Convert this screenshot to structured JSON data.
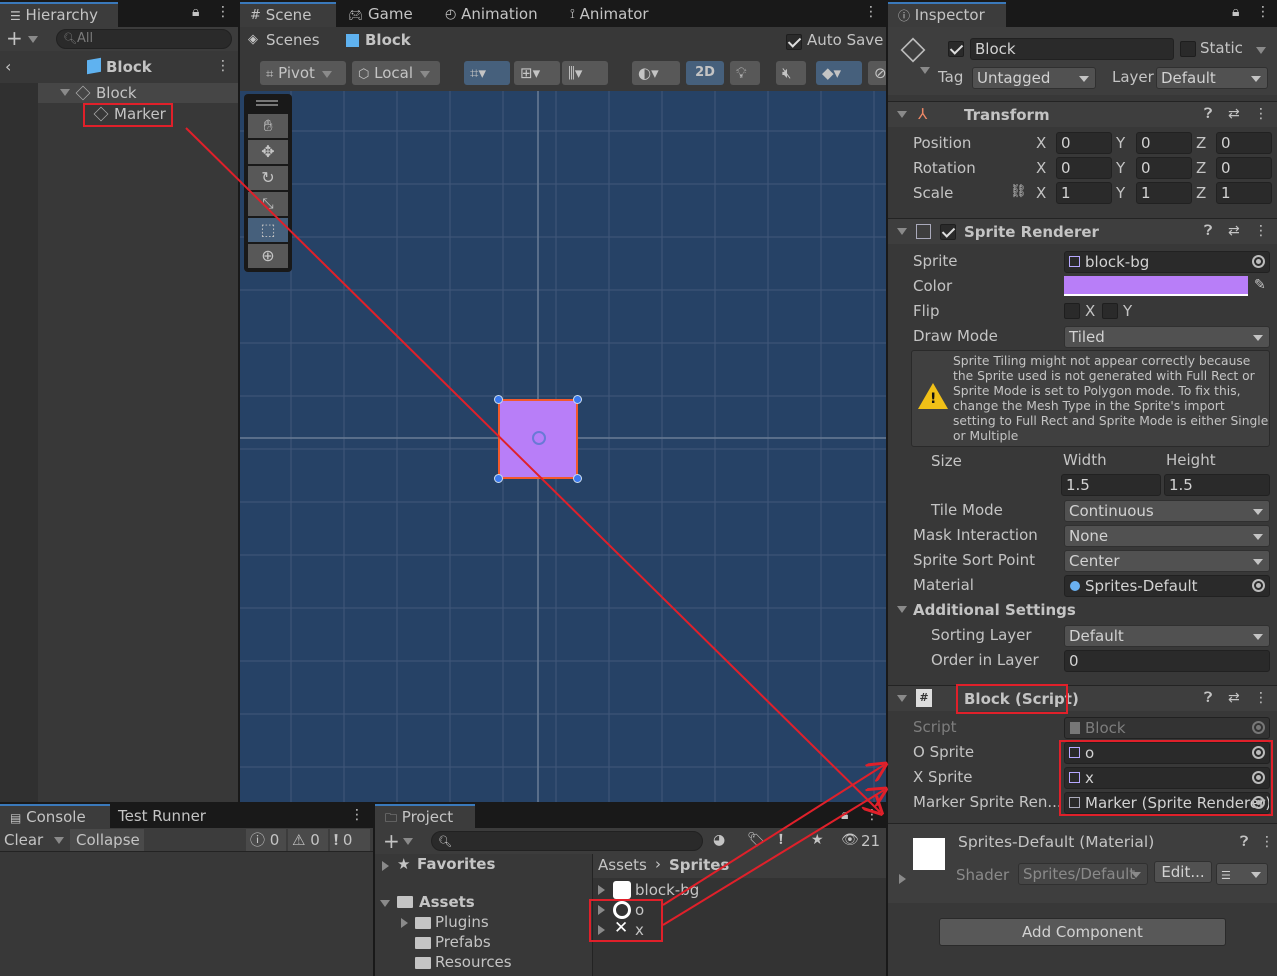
{
  "hierarchy": {
    "tab": "Hierarchy",
    "search_placeholder": "All",
    "scene": "Block",
    "items": [
      "Block",
      "Marker"
    ]
  },
  "scene_tabs": [
    "Scene",
    "Game",
    "Animation",
    "Animator"
  ],
  "scene": {
    "breadcrumb_root": "Scenes",
    "breadcrumb_item": "Block",
    "auto_save": "Auto Save",
    "pivot": "Pivot",
    "local": "Local",
    "mode_2d": "2D",
    "object_color": "#b87ef8"
  },
  "console": {
    "tab": "Console",
    "tab2": "Test Runner",
    "clear": "Clear",
    "collapse": "Collapse",
    "counts": [
      "0",
      "0",
      "0"
    ]
  },
  "project": {
    "tab": "Project",
    "hidden_count": "21",
    "favorites": "Favorites",
    "assets": "Assets",
    "folders": [
      "Plugins",
      "Prefabs",
      "Resources"
    ],
    "breadcrumb_root": "Assets",
    "breadcrumb_item": "Sprites",
    "files": [
      "block-bg",
      "o",
      "x"
    ]
  },
  "inspector": {
    "tab": "Inspector",
    "object_name": "Block",
    "static": "Static",
    "tag_label": "Tag",
    "tag": "Untagged",
    "layer_label": "Layer",
    "layer": "Default",
    "transform": {
      "title": "Transform",
      "rows": [
        {
          "label": "Position",
          "x": "0",
          "y": "0",
          "z": "0"
        },
        {
          "label": "Rotation",
          "x": "0",
          "y": "0",
          "z": "0"
        },
        {
          "label": "Scale",
          "x": "1",
          "y": "1",
          "z": "1"
        }
      ],
      "axis": [
        "X",
        "Y",
        "Z"
      ]
    },
    "sprite_renderer": {
      "title": "Sprite Renderer",
      "sprite_label": "Sprite",
      "sprite": "block-bg",
      "color_label": "Color",
      "color": "#b87ef8",
      "flip_label": "Flip",
      "flip_x": "X",
      "flip_y": "Y",
      "draw_mode_label": "Draw Mode",
      "draw_mode": "Tiled",
      "warning": "Sprite Tiling might not appear correctly because the Sprite used is not generated with Full Rect or Sprite Mode is set to Polygon mode. To fix this, change the Mesh Type in the Sprite's import setting to Full Rect and Sprite Mode is either Single or Multiple",
      "size_label": "Size",
      "width_label": "Width",
      "height_label": "Height",
      "width": "1.5",
      "height": "1.5",
      "tile_mode_label": "Tile Mode",
      "tile_mode": "Continuous",
      "mask_label": "Mask Interaction",
      "mask": "None",
      "sort_point_label": "Sprite Sort Point",
      "sort_point": "Center",
      "material_label": "Material",
      "material": "Sprites-Default",
      "additional": "Additional Settings",
      "sorting_layer_label": "Sorting Layer",
      "sorting_layer": "Default",
      "order_label": "Order in Layer",
      "order": "0"
    },
    "block_script": {
      "title": "Block (Script)",
      "script_label": "Script",
      "script": "Block",
      "o_label": "O Sprite",
      "o_value": "o",
      "x_label": "X Sprite",
      "x_value": "x",
      "marker_label": "Marker Sprite Ren...",
      "marker_value": "Marker (Sprite Renderer)"
    },
    "material": {
      "title": "Sprites-Default (Material)",
      "shader_label": "Shader",
      "shader": "Sprites/Default",
      "edit": "Edit..."
    },
    "add_component": "Add Component"
  },
  "annotation_color": "#e0202a"
}
